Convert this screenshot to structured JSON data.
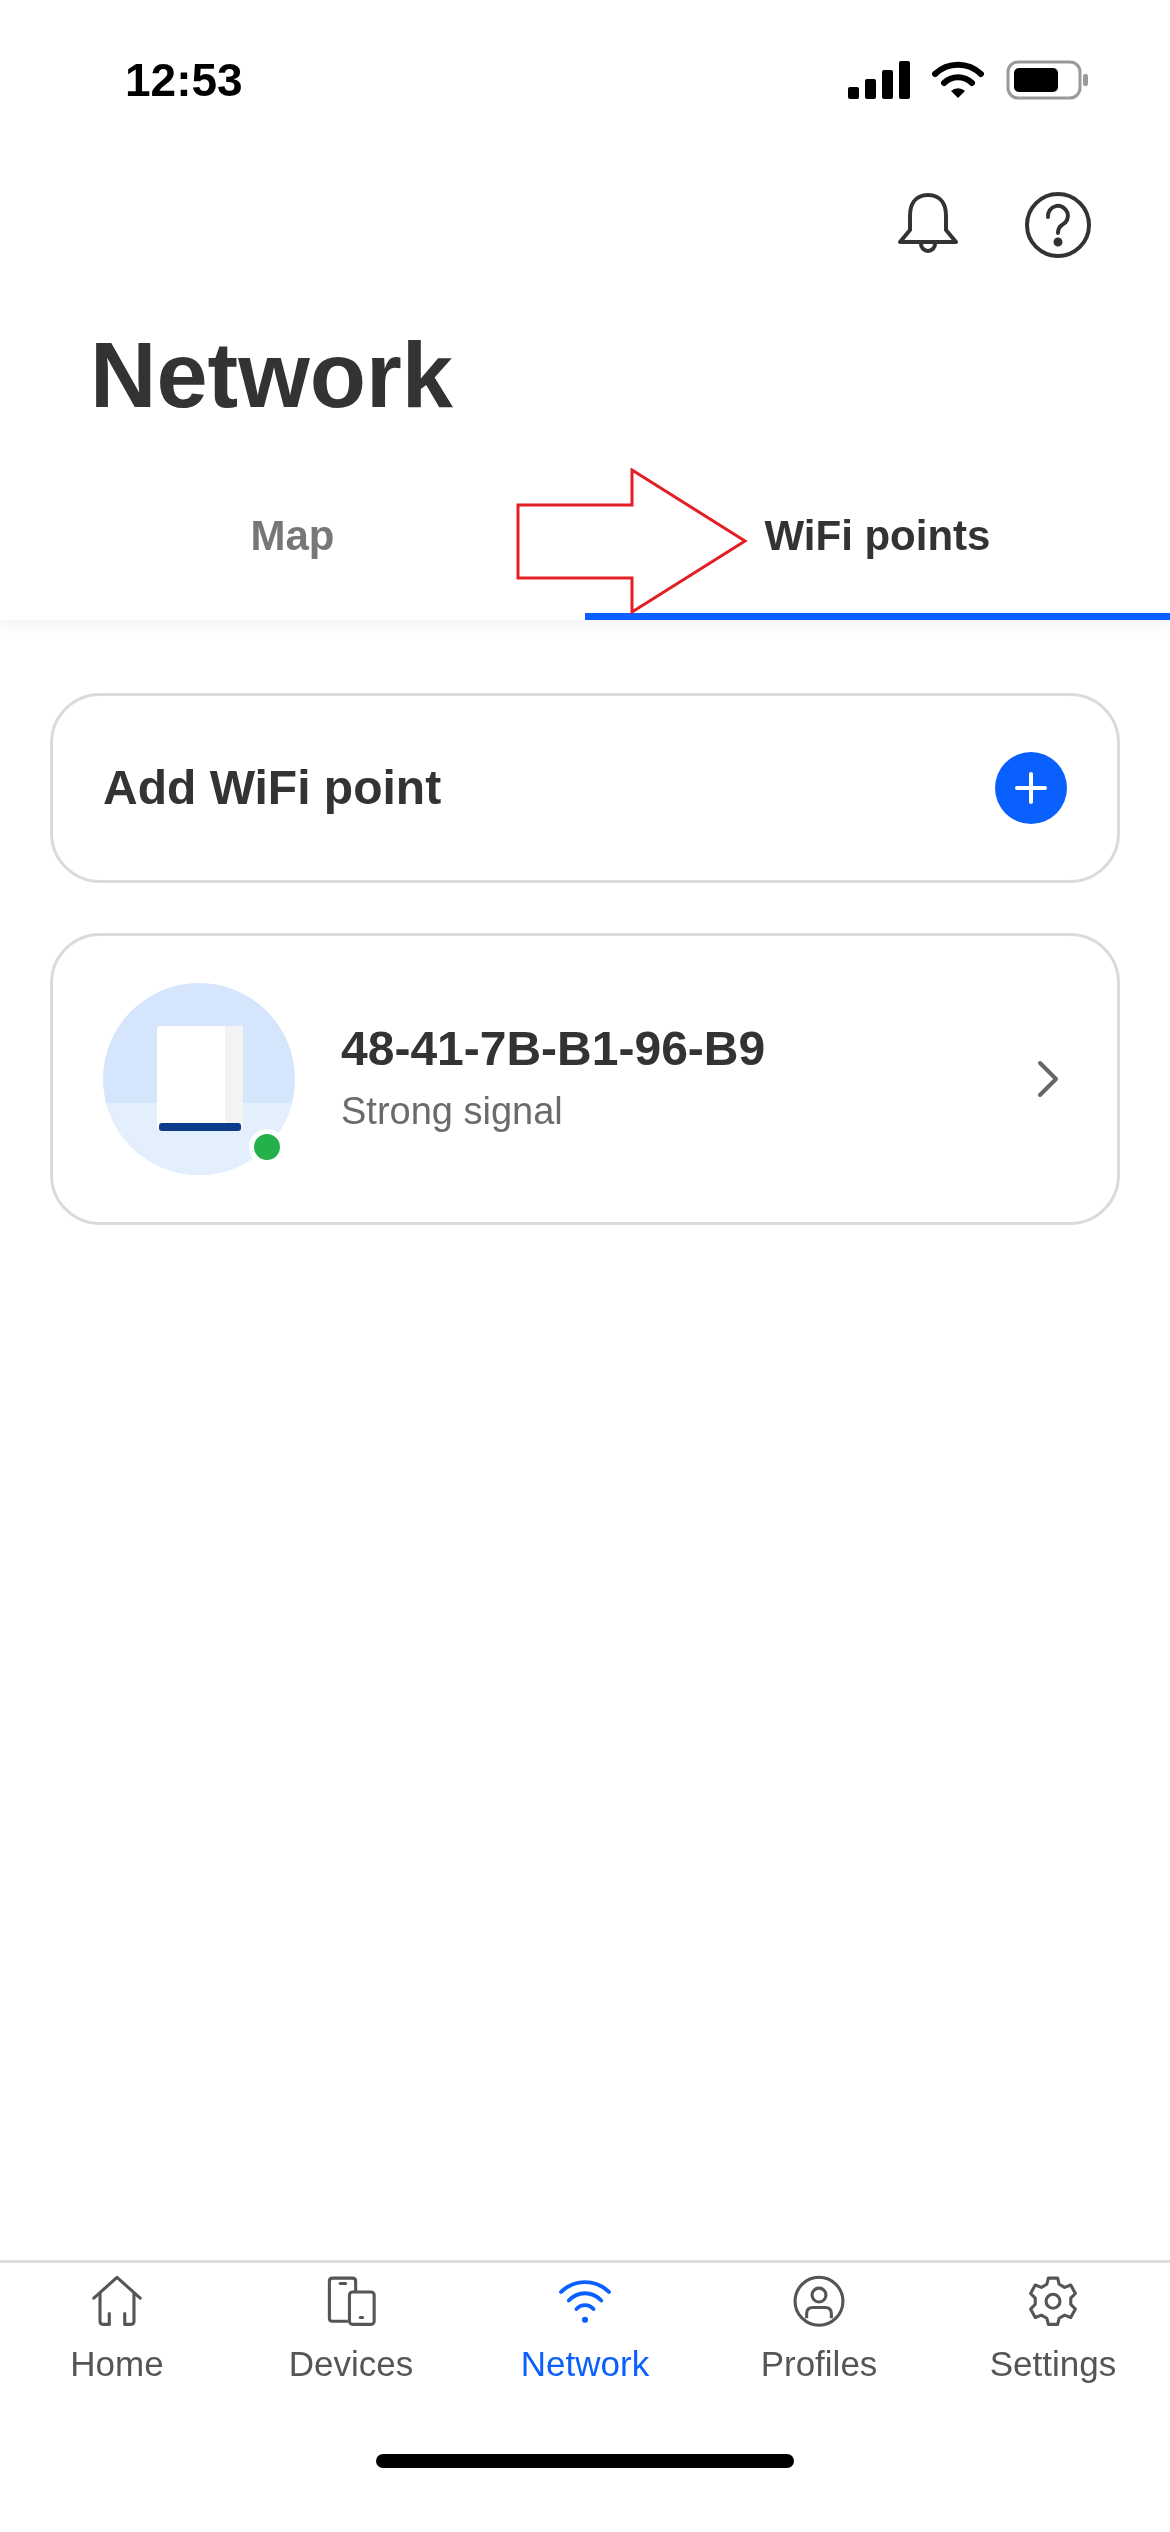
{
  "status_bar": {
    "time": "12:53"
  },
  "header": {
    "title": "Network"
  },
  "tabs": [
    {
      "label": "Map",
      "selected": false
    },
    {
      "label": "WiFi points",
      "selected": true
    }
  ],
  "add_card": {
    "label": "Add WiFi point"
  },
  "wifi_points": [
    {
      "name": "48-41-7B-B1-96-B9",
      "subtitle": "Strong signal",
      "online": true
    }
  ],
  "bottom_nav": [
    {
      "label": "Home",
      "kind": "home",
      "selected": false
    },
    {
      "label": "Devices",
      "kind": "devices",
      "selected": false
    },
    {
      "label": "Network",
      "kind": "wifi",
      "selected": true
    },
    {
      "label": "Profiles",
      "kind": "profile",
      "selected": false
    },
    {
      "label": "Settings",
      "kind": "gear",
      "selected": false
    }
  ]
}
